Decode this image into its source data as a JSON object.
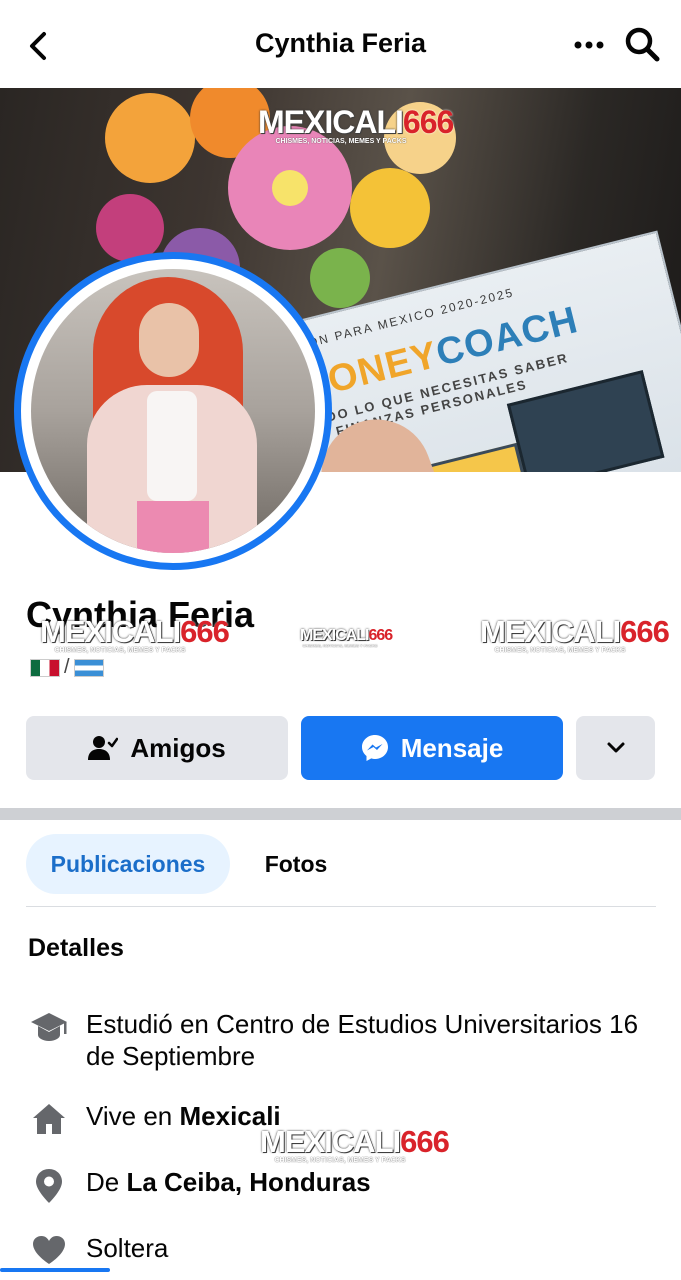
{
  "header": {
    "title": "Cynthia Feria",
    "back_icon": "back-arrow-icon",
    "more_icon": "ellipsis-icon",
    "search_icon": "search-icon"
  },
  "cover": {
    "watermark_main_a": "MEXICALI",
    "watermark_main_b": "666",
    "watermark_sub": "CHISMES, NOTICIAS, MEMES Y PACKS",
    "book_top": "EDICIÓN PARA MEXICO  2020-2025",
    "book_title_a": "MONEY",
    "book_title_b": "COACH",
    "book_subtitle_1": "TODO LO QUE NECESITAS SABER",
    "book_subtitle_2": "DE FINANZAS PERSONALES"
  },
  "profile": {
    "name": "Cynthia Feria",
    "flag_separator": "/"
  },
  "actions": {
    "friends_label": "Amigos",
    "message_label": "Mensaje"
  },
  "tabs": [
    {
      "label": "Publicaciones"
    },
    {
      "label": "Fotos"
    }
  ],
  "details": {
    "title": "Detalles",
    "education": "Estudió en Centro de Estudios Universitarios 16 de Septiembre",
    "lives_prefix": "Vive en ",
    "lives_city": "Mexicali",
    "from_prefix": "De ",
    "from_place": "La Ceiba, Honduras",
    "relationship": "Soltera"
  },
  "colors": {
    "accent": "#1877f2",
    "tab_active_bg": "#e7f3ff",
    "button_grey": "#e4e6eb",
    "watermark_red": "#d9232a"
  }
}
